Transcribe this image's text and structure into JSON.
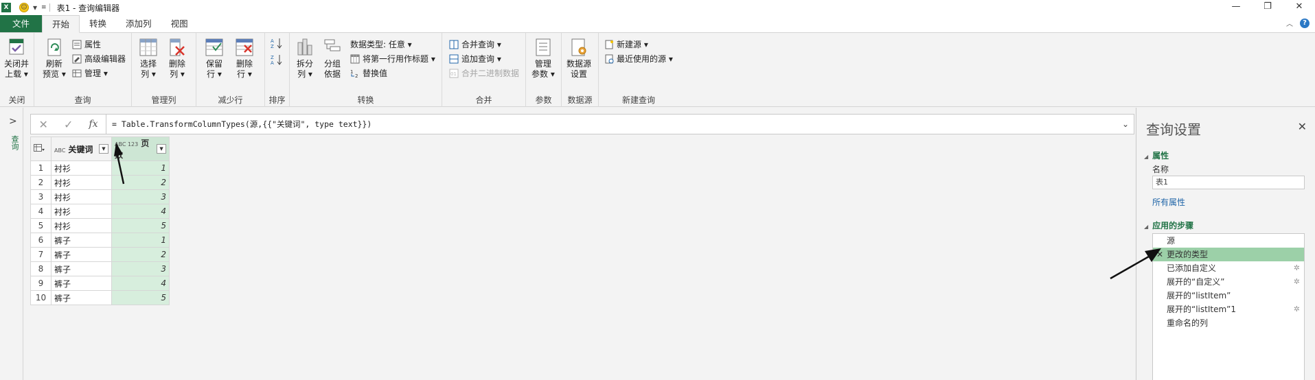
{
  "titlebar": {
    "app_logo": "X",
    "title": "表1 - 查询编辑器",
    "quick_access_caret": "▾",
    "minimize": "—",
    "restore": "❐",
    "close": "✕"
  },
  "tabs": [
    {
      "label": "文件"
    },
    {
      "label": "开始"
    },
    {
      "label": "转换"
    },
    {
      "label": "添加列"
    },
    {
      "label": "视图"
    }
  ],
  "ribbon": {
    "close": {
      "label_line1": "关闭并",
      "label_line2": "上载 ▾",
      "group": "关闭"
    },
    "query": {
      "refresh_line1": "刷新",
      "refresh_line2": "预览 ▾",
      "properties": "属性",
      "advanced_editor": "高级编辑器",
      "manage": "管理 ▾",
      "group": "查询"
    },
    "manage_columns": {
      "choose_line1": "选择",
      "choose_line2": "列 ▾",
      "remove_line1": "删除",
      "remove_line2": "列 ▾",
      "group": "管理列"
    },
    "reduce_rows": {
      "keep_line1": "保留",
      "keep_line2": "行 ▾",
      "remove_line1": "删除",
      "remove_line2": "行 ▾",
      "group": "减少行"
    },
    "sort": {
      "group": "排序"
    },
    "transform": {
      "split_line1": "拆分",
      "split_line2": "列 ▾",
      "group_line1": "分组",
      "group_line2": "依据",
      "data_type": "数据类型: 任意 ▾",
      "first_row_header": "将第一行用作标题 ▾",
      "replace_values": "替换值",
      "group": "转换"
    },
    "combine": {
      "merge_queries": "合并查询 ▾",
      "append_queries": "追加查询 ▾",
      "combine_binaries": "合并二进制数据",
      "group": "合并"
    },
    "parameters": {
      "line1": "管理",
      "line2": "参数 ▾",
      "group": "参数"
    },
    "data_sources": {
      "line1": "数据源",
      "line2": "设置",
      "group": "数据源"
    },
    "new_query": {
      "new_source": "新建源 ▾",
      "recent_sources": "最近使用的源 ▾",
      "group": "新建查询"
    }
  },
  "leftnav": {
    "chevron": ">",
    "label": "查询"
  },
  "formula": {
    "cancel": "✕",
    "commit": "✓",
    "fx": "fx",
    "text": "= Table.TransformColumnTypes(源,{{\"关键词\", type text}})",
    "expand": "⌄"
  },
  "grid": {
    "columns": [
      {
        "type_icon": "ABC",
        "name": "关键词"
      },
      {
        "type_icon": "ABC 123",
        "name": "页数"
      }
    ],
    "rows": [
      {
        "n": "1",
        "kw": "衬衫",
        "pg": "1"
      },
      {
        "n": "2",
        "kw": "衬衫",
        "pg": "2"
      },
      {
        "n": "3",
        "kw": "衬衫",
        "pg": "3"
      },
      {
        "n": "4",
        "kw": "衬衫",
        "pg": "4"
      },
      {
        "n": "5",
        "kw": "衬衫",
        "pg": "5"
      },
      {
        "n": "6",
        "kw": "裤子",
        "pg": "1"
      },
      {
        "n": "7",
        "kw": "裤子",
        "pg": "2"
      },
      {
        "n": "8",
        "kw": "裤子",
        "pg": "3"
      },
      {
        "n": "9",
        "kw": "裤子",
        "pg": "4"
      },
      {
        "n": "10",
        "kw": "裤子",
        "pg": "5"
      }
    ]
  },
  "settings": {
    "title": "查询设置",
    "close": "✕",
    "properties_header": "属性",
    "name_label": "名称",
    "name_value": "表1",
    "all_properties": "所有属性",
    "steps_header": "应用的步骤",
    "steps": [
      {
        "label": "源",
        "gear": false
      },
      {
        "label": "更改的类型",
        "gear": false
      },
      {
        "label": "已添加自定义",
        "gear": true
      },
      {
        "label": "展开的“自定义”",
        "gear": true
      },
      {
        "label": "展开的“listItem”",
        "gear": false
      },
      {
        "label": "展开的“listItem”1",
        "gear": true
      },
      {
        "label": "重命名的列",
        "gear": false
      }
    ]
  }
}
